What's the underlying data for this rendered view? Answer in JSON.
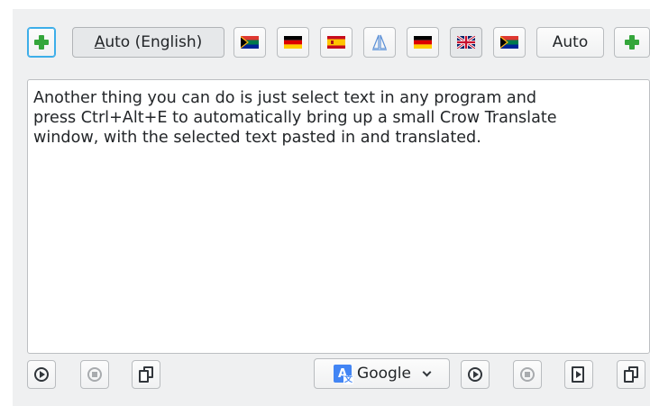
{
  "source_bar": {
    "add_language_label": "+",
    "auto_detect_label": "Auto (English)",
    "auto_detect_mnemonic": "A",
    "auto_detect_rest": "uto (English)",
    "source_flags": [
      "south-africa-flag",
      "germany-flag",
      "spain-flag"
    ],
    "swap_icon": "swap-languages-icon"
  },
  "target_bar": {
    "target_flags": [
      "germany-flag",
      "united-kingdom-flag",
      "south-africa-flag"
    ],
    "auto_label": "Auto",
    "add_language_label": "+"
  },
  "editor": {
    "text": "Another thing you can do is just select text in any program and\npress Ctrl+Alt+E to automatically bring up a small Crow Translate\nwindow, with the selected text pasted in and translated."
  },
  "bottom_bar": {
    "engine_label": "Google",
    "engine_icon": "google-translate-icon"
  },
  "colors": {
    "accent": "#3daee9",
    "plus_green": "#35a63b",
    "window_bg": "#eff0f1"
  }
}
